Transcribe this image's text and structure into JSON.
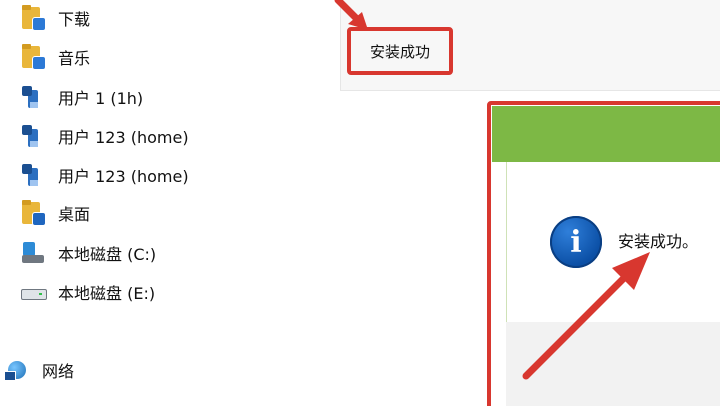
{
  "sidebar": {
    "items": [
      {
        "label": "下载",
        "icon": "downloads-folder-icon"
      },
      {
        "label": "音乐",
        "icon": "music-folder-icon"
      },
      {
        "label": "用户 1 (1h)",
        "icon": "network-user-icon"
      },
      {
        "label": "用户 123 (home)",
        "icon": "network-user-icon"
      },
      {
        "label": "用户 123 (home)",
        "icon": "network-user-icon"
      },
      {
        "label": "桌面",
        "icon": "desktop-folder-icon"
      },
      {
        "label": "本地磁盘 (C:)",
        "icon": "system-drive-icon"
      },
      {
        "label": "本地磁盘 (E:)",
        "icon": "drive-icon"
      }
    ],
    "network": {
      "label": "网络",
      "icon": "network-icon"
    }
  },
  "topbar": {
    "status_text": "安装成功"
  },
  "dialog": {
    "message": "安装成功。",
    "info_glyph": "i"
  },
  "colors": {
    "highlight": "#d8372f",
    "dialog_header": "#7db845",
    "info_blue": "#0b4fa5"
  }
}
